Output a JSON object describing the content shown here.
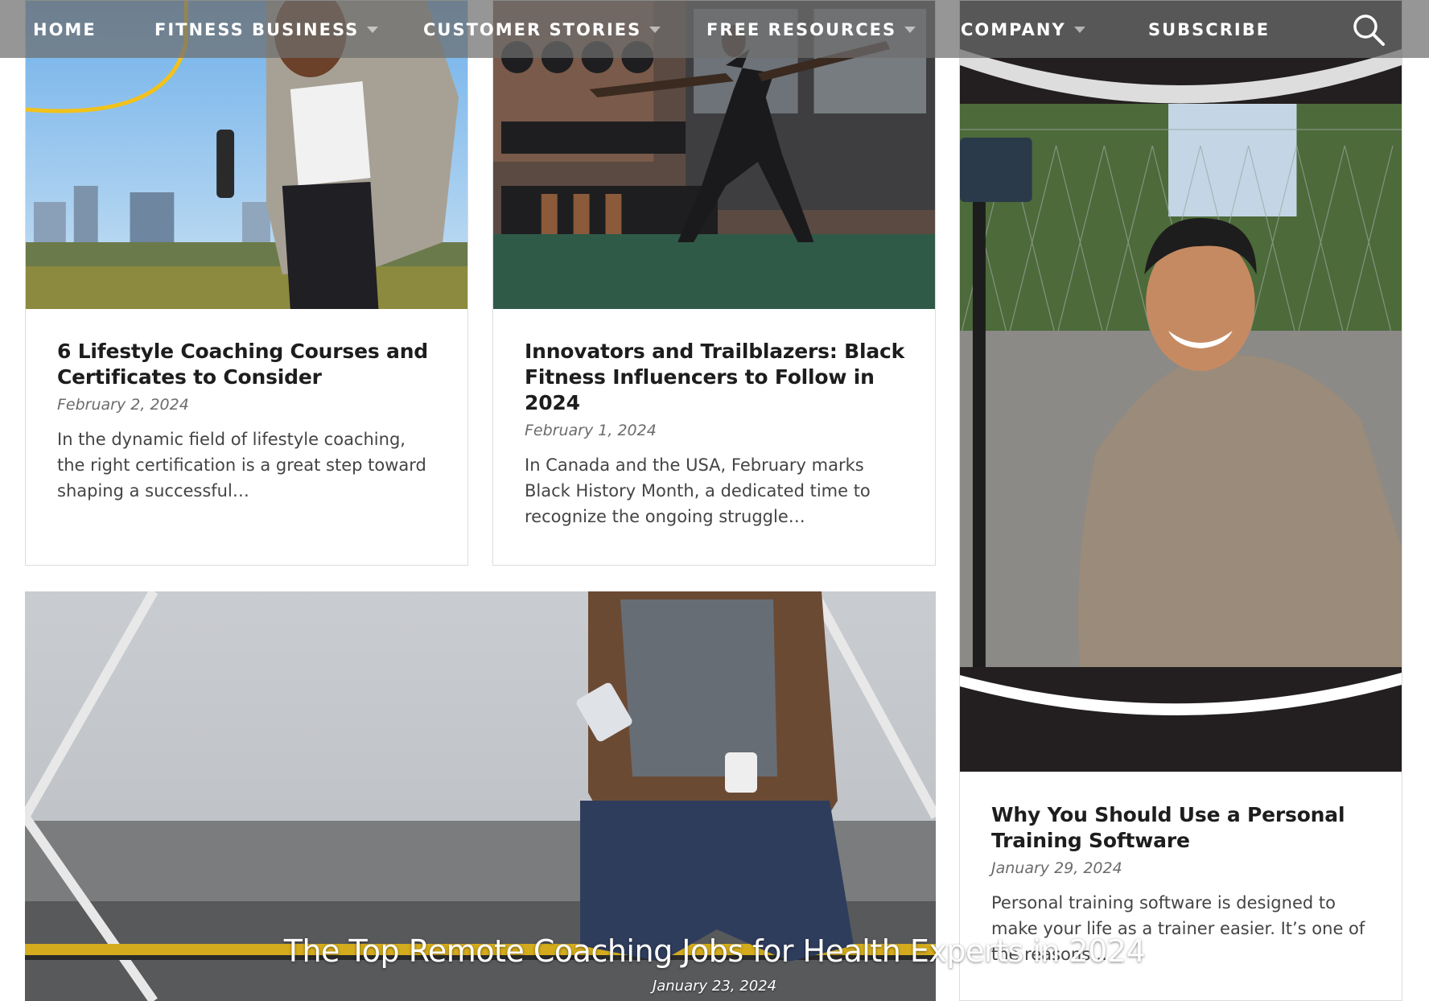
{
  "nav": {
    "items": [
      {
        "label": "HOME",
        "has_dropdown": false
      },
      {
        "label": "FITNESS BUSINESS",
        "has_dropdown": true
      },
      {
        "label": "CUSTOMER STORIES",
        "has_dropdown": true
      },
      {
        "label": "FREE RESOURCES",
        "has_dropdown": true
      },
      {
        "label": "COMPANY",
        "has_dropdown": true
      },
      {
        "label": "SUBSCRIBE",
        "has_dropdown": false
      }
    ],
    "search_icon": "search-icon"
  },
  "posts": [
    {
      "title": "6 Lifestyle Coaching Courses and Certificates to Consider",
      "date": "February 2, 2024",
      "excerpt": "In the dynamic field of lifestyle coaching, the right certification is a great step toward shaping a successful…"
    },
    {
      "title": "Innovators and Trailblazers: Black Fitness Influencers to Follow in 2024",
      "date": "February 1, 2024",
      "excerpt": "In Canada and the USA, February marks Black History Month, a dedicated time to recognize the ongoing struggle…"
    },
    {
      "title": "Why You Should Use a Personal Training Software",
      "date": "January 29, 2024",
      "excerpt": "Personal training software is designed to make your life as a trainer easier. It’s one of the reasons…"
    }
  ],
  "featured": {
    "title": "The Top Remote Coaching Jobs for Health Experts in 2024",
    "date": "January 23, 2024"
  },
  "colors": {
    "accent_yellow": "#f2c21b",
    "nav_overlay": "rgba(110,110,110,0.72)",
    "card_border": "#dcdcdc"
  }
}
